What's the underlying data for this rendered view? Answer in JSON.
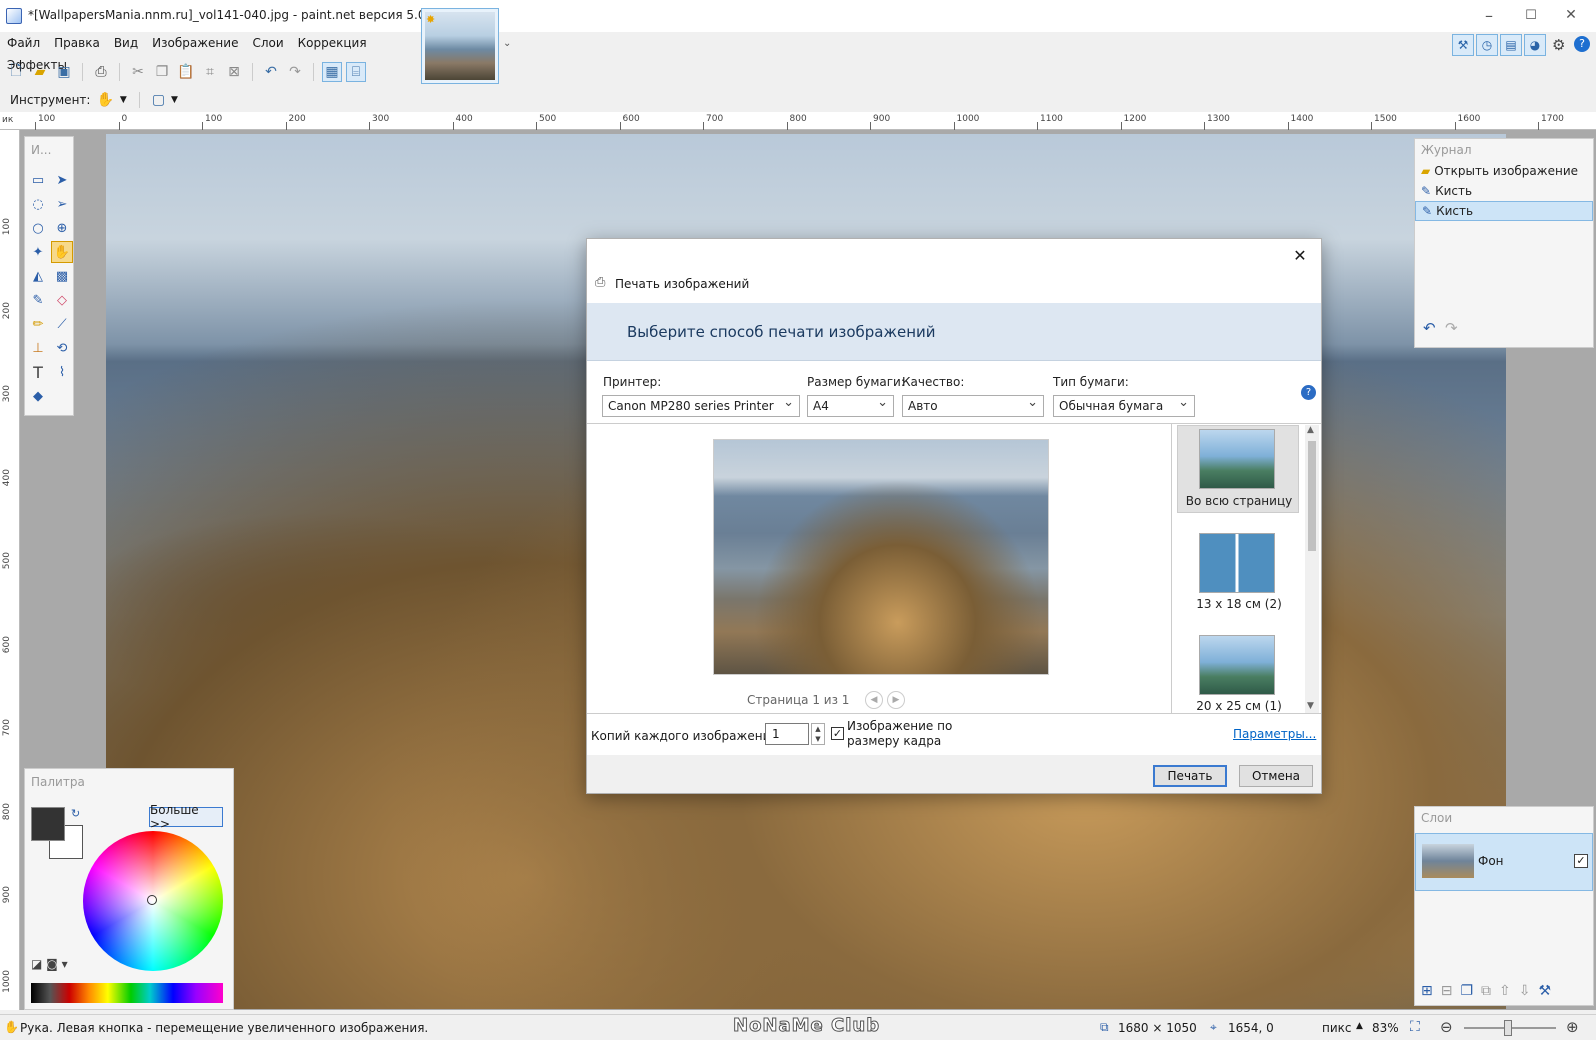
{
  "window": {
    "title": "*[WallpapersMania.nnm.ru]_vol141-040.jpg - paint.net версия 5.0.11",
    "min": "–",
    "max": "☐",
    "close": "✕"
  },
  "menu": [
    "Файл",
    "Правка",
    "Вид",
    "Изображение",
    "Слои",
    "Коррекция",
    "Эффекты"
  ],
  "toolbar": {
    "instrument_label": "Инструмент:"
  },
  "ruler": {
    "unit": "ик",
    "h_ticks": [
      "100",
      "0",
      "100",
      "200",
      "300",
      "400",
      "500",
      "600",
      "700",
      "800",
      "900",
      "1000",
      "1100",
      "1200",
      "1300",
      "1400",
      "1500",
      "1600",
      "1700"
    ],
    "v_ticks": [
      "100",
      "200",
      "300",
      "400",
      "500",
      "600",
      "700",
      "800",
      "900",
      "1000"
    ]
  },
  "tools_panel": {
    "title": "И..."
  },
  "history": {
    "title": "Журнал",
    "items": [
      "Открыть изображение",
      "Кисть",
      "Кисть"
    ]
  },
  "layers": {
    "title": "Слои",
    "layer_name": "Фон"
  },
  "palette": {
    "title": "Палитра",
    "more": "Больше >>"
  },
  "dialog": {
    "title": "Печать изображений",
    "header": "Выберите способ печати изображений",
    "printer_label": "Принтер:",
    "printer_value": "Canon MP280 series Printer",
    "paper_size_label": "Размер бумаги:",
    "paper_size_value": "A4",
    "quality_label": "Качество:",
    "quality_value": "Авто",
    "paper_type_label": "Тип бумаги:",
    "paper_type_value": "Обычная бумага",
    "page_text": "Страница 1 из 1",
    "layouts": [
      "Во всю страницу",
      "13 х 18 см (2)",
      "20 х 25 см (1)"
    ],
    "copies_label": "Копий каждого изображения:",
    "copies_value": "1",
    "fit_label_1": "Изображение по",
    "fit_label_2": "размеру кадра",
    "params_link": "Параметры...",
    "print_btn": "Печать",
    "cancel_btn": "Отмена"
  },
  "status": {
    "hint": "Рука. Левая кнопка - перемещение увеличенного изображения.",
    "size": "1680 × 1050",
    "coords": "1654, 0",
    "units": "пикс",
    "zoom": "83%"
  },
  "watermark": "NoNaMe Club"
}
